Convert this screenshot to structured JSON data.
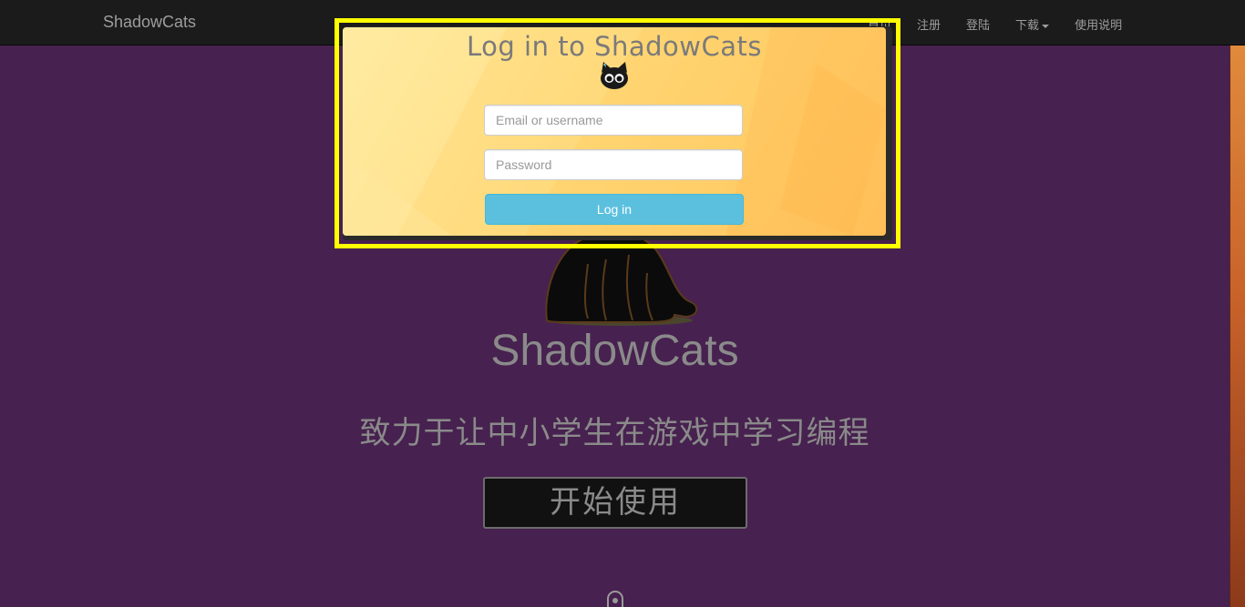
{
  "navbar": {
    "brand": "ShadowCats",
    "items": [
      {
        "label": "首页"
      },
      {
        "label": "注册"
      },
      {
        "label": "登陆"
      },
      {
        "label": "下载",
        "has_dropdown": true
      },
      {
        "label": "使用说明"
      }
    ]
  },
  "hero": {
    "logo_icon": "black-cat-icon",
    "title": "ShadowCats",
    "subtitle": "致力于让中小学生在游戏中学习编程",
    "start_button": "开始使用",
    "scroll_icon": "mouse-scroll-icon"
  },
  "login_modal": {
    "title": "Log in to ShadowCats",
    "logo_icon": "cat-face-icon",
    "email_placeholder": "Email or username",
    "password_placeholder": "Password",
    "submit_label": "Log in"
  },
  "colors": {
    "page_background": "#47214f",
    "navbar_background": "#1b1b1b",
    "highlight_frame": "#ffff00",
    "modal_background": "#ffd978",
    "login_button": "#5bc0de"
  }
}
